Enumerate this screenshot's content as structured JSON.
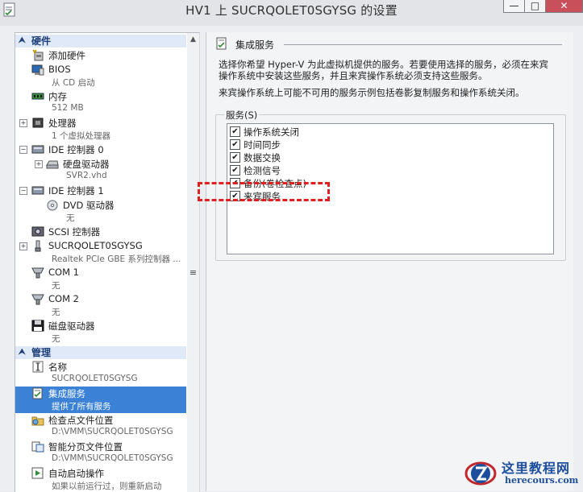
{
  "window": {
    "title": "HV1 上 SUCRQOLET0SGYSG 的设置",
    "minimize": "—",
    "maximize": "□",
    "close": "✕"
  },
  "tree": {
    "hardware_header": "硬件",
    "management_header": "管理",
    "scroll_grip": "≡",
    "items": [
      {
        "main": "添加硬件",
        "sub": "",
        "icon": "add-hardware-icon"
      },
      {
        "main": "BIOS",
        "sub": "从 CD 启动",
        "icon": "bios-icon"
      },
      {
        "main": "内存",
        "sub": "512 MB",
        "icon": "memory-icon"
      },
      {
        "main": "处理器",
        "sub": "1 个虚拟处理器",
        "icon": "processor-icon"
      },
      {
        "main": "IDE 控制器 0",
        "sub": "",
        "icon": "ide-controller-icon"
      },
      {
        "main": "硬盘驱动器",
        "sub": "SVR2.vhd",
        "icon": "hard-drive-icon"
      },
      {
        "main": "IDE 控制器 1",
        "sub": "",
        "icon": "ide-controller-icon"
      },
      {
        "main": "DVD 驱动器",
        "sub": "无",
        "icon": "dvd-drive-icon"
      },
      {
        "main": "SCSI 控制器",
        "sub": "",
        "icon": "scsi-controller-icon"
      },
      {
        "main": "SUCRQOLET0SGYSG",
        "sub": "Realtek PCIe GBE 系列控制器 ...",
        "icon": "network-adapter-icon"
      },
      {
        "main": "COM 1",
        "sub": "无",
        "icon": "com-port-icon"
      },
      {
        "main": "COM 2",
        "sub": "无",
        "icon": "com-port-icon"
      },
      {
        "main": "磁盘驱动器",
        "sub": "无",
        "icon": "diskette-icon"
      },
      {
        "main": "名称",
        "sub": "SUCRQOLET0SGYSG",
        "icon": "name-icon"
      },
      {
        "main": "集成服务",
        "sub": "提供了所有服务",
        "icon": "integration-services-icon"
      },
      {
        "main": "检查点文件位置",
        "sub": "D:\\VMM\\SUCRQOLET0SGYSG",
        "icon": "checkpoint-folder-icon"
      },
      {
        "main": "智能分页文件位置",
        "sub": "D:\\VMM\\SUCRQOLET0SGYSG",
        "icon": "smart-paging-icon"
      },
      {
        "main": "自动启动操作",
        "sub": "如果以前运行过，则重新启动",
        "icon": "auto-start-icon"
      }
    ]
  },
  "content": {
    "section_title": "集成服务",
    "description1_line1": "选择你希望 Hyper-V 为此虚拟机提供的服务。若要使用选择的服务，必须在来宾",
    "description1_line2": "操作系统中安装这些服务，并且来宾操作系统必须支持这些服务。",
    "description2": "来宾操作系统上可能不可用的服务示例包括卷影复制服务和操作系统关闭。",
    "group_label": "服务(S)",
    "services": [
      {
        "label": "操作系统关闭",
        "checked": true
      },
      {
        "label": "时间同步",
        "checked": true
      },
      {
        "label": "数据交换",
        "checked": true
      },
      {
        "label": "检测信号",
        "checked": true
      },
      {
        "label": "备份(卷检查点)",
        "checked": true
      },
      {
        "label": "来宾服务",
        "checked": true
      }
    ]
  },
  "watermark": {
    "title": "这里教程网",
    "url": "herecours.com"
  },
  "colors": {
    "selection": "#3b81d6",
    "section_header": "#dfe9f7",
    "highlight": "#e02020"
  }
}
